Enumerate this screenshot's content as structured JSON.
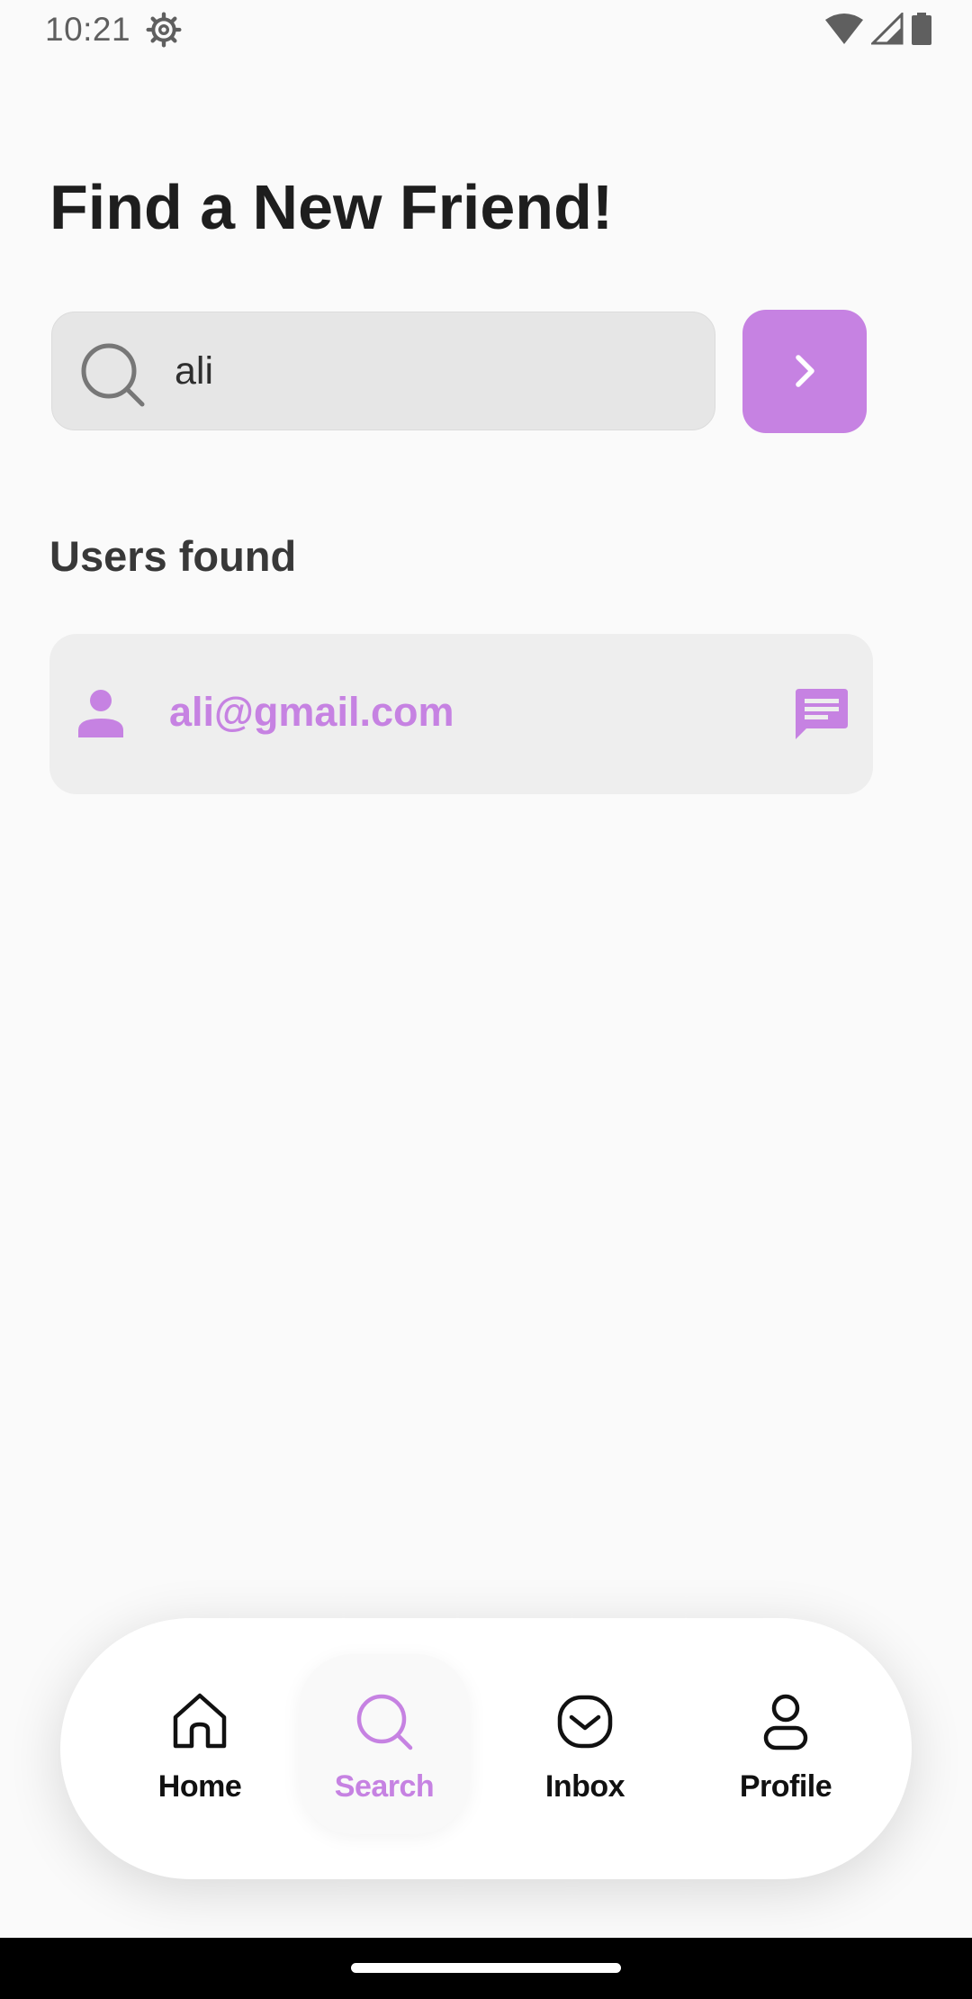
{
  "status_bar": {
    "time": "10:21",
    "icons": [
      "settings-gear-icon",
      "wifi-icon",
      "cell-signal-icon",
      "battery-icon"
    ]
  },
  "page": {
    "title": "Find a New Friend!"
  },
  "search": {
    "value": "ali",
    "icon": "search-icon",
    "submit_icon": "chevron-right-icon"
  },
  "results": {
    "heading": "Users found",
    "items": [
      {
        "email": "ali@gmail.com",
        "leading_icon": "person-icon",
        "action_icon": "message-icon"
      }
    ]
  },
  "bottom_nav": {
    "items": [
      {
        "label": "Home",
        "icon": "home-icon",
        "active": false
      },
      {
        "label": "Search",
        "icon": "search-icon",
        "active": true
      },
      {
        "label": "Inbox",
        "icon": "inbox-icon",
        "active": false
      },
      {
        "label": "Profile",
        "icon": "profile-icon",
        "active": false
      }
    ]
  },
  "colors": {
    "accent": "#c682e2",
    "background": "#fafafa",
    "search_field": "#e6e6e6",
    "card": "#eeeeee",
    "title_text": "#1e1e1e"
  }
}
